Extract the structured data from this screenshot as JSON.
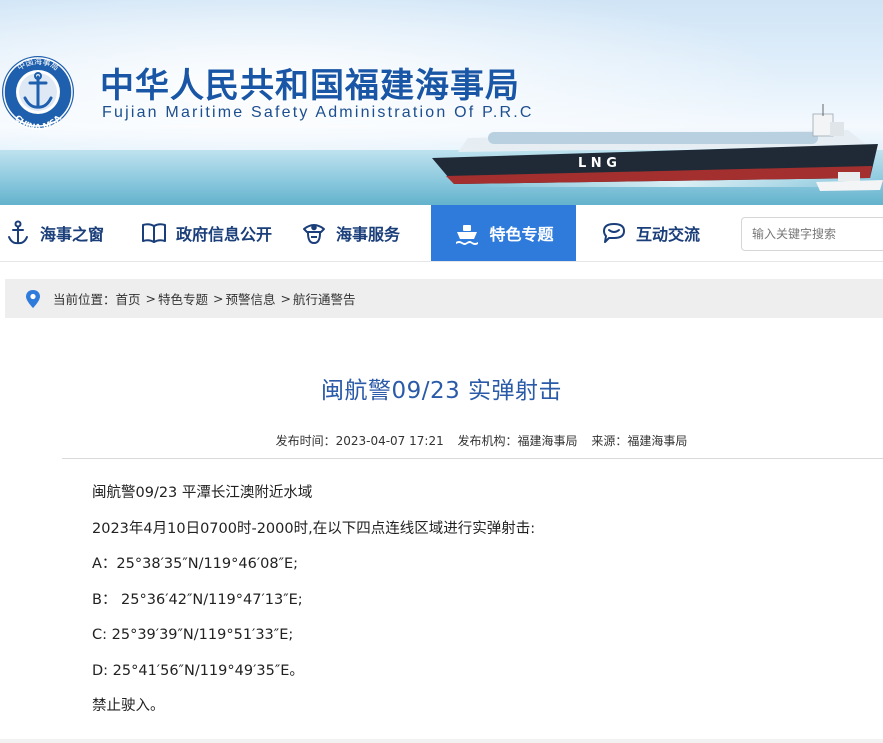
{
  "header": {
    "title_cn": "中华人民共和国福建海事局",
    "title_en": "Fujian Maritime Safety Administration Of P.R.C",
    "logo_text_top": "中国海事局",
    "logo_text_bottom": "CHINA MSA",
    "ship_hull_text": "L  N  G"
  },
  "nav": {
    "items": [
      {
        "label": "海事之窗",
        "icon": "anchor-icon"
      },
      {
        "label": "政府信息公开",
        "icon": "book-icon"
      },
      {
        "label": "海事服务",
        "icon": "officer-cap-icon"
      },
      {
        "label": "特色专题",
        "icon": "ship-icon",
        "active": true
      },
      {
        "label": "互动交流",
        "icon": "chat-icon"
      }
    ],
    "search": {
      "placeholder": "输入关键字搜索"
    }
  },
  "breadcrumb": {
    "prefix": "当前位置：",
    "items": [
      "首页",
      "特色专题",
      "预警信息",
      "航行通警告"
    ]
  },
  "article": {
    "title": "闽航警09/23 实弹射击",
    "meta": {
      "publish_time": "发布时间：2023-04-07 17:21",
      "publisher": "发布机构：福建海事局",
      "source": "来源：福建海事局"
    },
    "paragraphs": [
      "闽航警09/23  平潭长江澳附近水域",
      "2023年4月10日0700时-2000时,在以下四点连线区域进行实弹射击:",
      "A：25°38′35″N/119°46′08″E;",
      "B： 25°36′42″N/119°47′13″E;",
      "C: 25°39′39″N/119°51′33″E;",
      "D: 25°41′56″N/119°49′35″E。",
      "禁止驶入。"
    ]
  },
  "colors": {
    "brand_blue": "#1a56a6",
    "nav_active": "#2f7bdc",
    "title_blue": "#2a5aa8"
  }
}
